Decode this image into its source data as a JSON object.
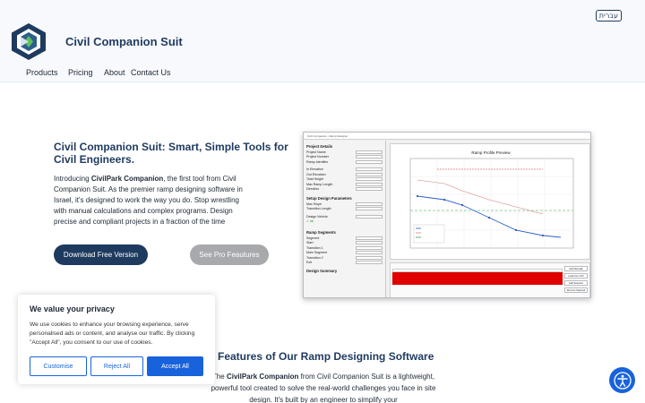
{
  "header": {
    "lang_button": "עברית",
    "brand": "Civil Companion Suit",
    "nav": [
      "Products",
      "Pricing",
      "About",
      "Contact Us"
    ]
  },
  "hero": {
    "title": "Civil Companion Suit: Smart, Simple Tools for Civil Engineers.",
    "intro_pre": "Introducing ",
    "intro_bold1": "CivilPark Companion",
    "intro_mid1": ", the first tool from Civil Companion Suit. As the premier ramp designing software in Israel, it's designed to work the way you do. Stop wrestling with manual calculations and complex programs. Design precise and compliant projects in a fraction of the time",
    "download_button": "Download Free Version",
    "pro_button": "See Pro Feautures"
  },
  "app_screenshot": {
    "title_bar": "Civil Companion - Ramp Designer",
    "sections": [
      "Project Details",
      "Setup Design Parameters",
      "Ramp Segments",
      "Design Summary"
    ],
    "chart_title": "Ramp Profile Preview",
    "side_buttons": [
      "Add Manually",
      "Load from CSV",
      "Edit Selected",
      "Remove Selected"
    ]
  },
  "cookie": {
    "title": "We value your privacy",
    "text": "We use cookies to enhance your browsing experience, serve personalised ads or content, and analyse our traffic. By clicking \"Accept All\", you consent to our use of cookies.",
    "customise": "Customise",
    "reject": "Reject All",
    "accept": "Accept All"
  },
  "features": {
    "title": "Features of Our Ramp Designing Software",
    "text_pre": "The ",
    "text_bold": "CivilPark Companion",
    "text_post": " from Civil Companion Suit is a lightweight, powerful tool created to solve the real-world challenges you face in site design. It's built by an engineer to simplify your"
  },
  "colors": {
    "brand_navy": "#1e3a5f",
    "cookie_blue": "#1863dc",
    "pro_gray": "#a7a9ac"
  },
  "icons": {
    "logo": "hexagon-logo-icon",
    "accessibility": "accessibility-icon"
  }
}
